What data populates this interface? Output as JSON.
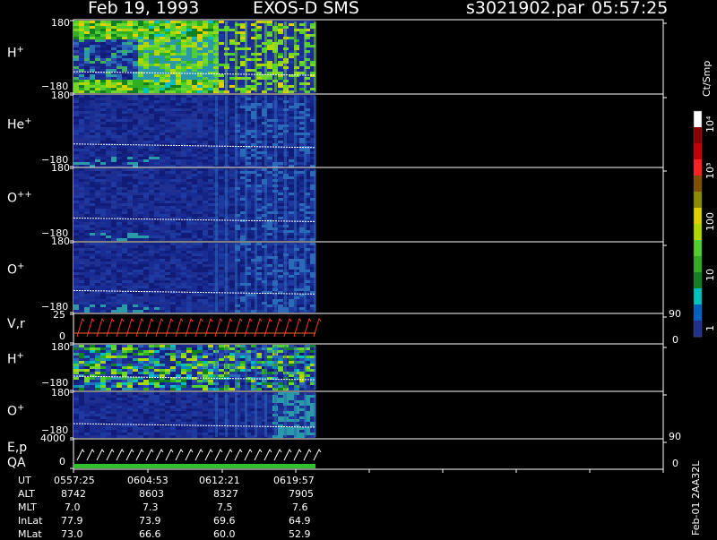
{
  "header": {
    "date": "Feb 19, 1993",
    "instrument": "EXOS-D SMS",
    "file": "s3021902.par",
    "time": "05:57:25"
  },
  "panels": [
    {
      "id": "p1",
      "species": "H",
      "charge": "+",
      "ytop": "180",
      "ybot": "−180",
      "scheme": "h"
    },
    {
      "id": "p2",
      "species": "He",
      "charge": "+",
      "ytop": "180",
      "ybot": "−180",
      "scheme": "low"
    },
    {
      "id": "p3",
      "species": "O",
      "charge": "++",
      "ytop": "180",
      "ybot": "−180",
      "scheme": "low"
    },
    {
      "id": "p4",
      "species": "O",
      "charge": "+",
      "ytop": "180",
      "ybot": "−180",
      "scheme": "low"
    },
    {
      "id": "p5",
      "species": "V,r",
      "ytop": "25",
      "ybot": "0",
      "right_top": "90",
      "right_bot": "0",
      "scheme": "line"
    },
    {
      "id": "p6",
      "species": "H",
      "charge": "+",
      "ytop": "180",
      "ybot": "−180",
      "scheme": "h2"
    },
    {
      "id": "p7",
      "species": "O",
      "charge": "+",
      "ytop": "180",
      "ybot": "−180",
      "scheme": "low2"
    },
    {
      "id": "p8",
      "species": "E,p",
      "species2": "QA",
      "ytop": "4000",
      "ybot": "0",
      "right_top": "90",
      "right_bot": "0",
      "scheme": "line2"
    }
  ],
  "footer": {
    "row_labels": [
      "UT",
      "ALT",
      "MLT",
      "InLat",
      "MLat"
    ],
    "columns": [
      [
        "0557:25",
        "8742",
        "7.0",
        "77.9",
        "73.0"
      ],
      [
        "0604:53",
        "8603",
        "7.3",
        "73.9",
        "66.6"
      ],
      [
        "0612:21",
        "8327",
        "7.5",
        "69.6",
        "60.0"
      ],
      [
        "0619:57",
        "7905",
        "7.6",
        "64.9",
        "52.9"
      ]
    ],
    "side_label": "Feb-01 2AA32L"
  },
  "colorbar": {
    "title": "Ct/Smp",
    "labels": [
      "10⁴",
      "10³",
      "100",
      "10",
      "1"
    ],
    "colors": [
      "#ffffff",
      "#8b0000",
      "#c00000",
      "#ff2020",
      "#805000",
      "#8c8c00",
      "#e0d000",
      "#b0d800",
      "#50d030",
      "#30b020",
      "#108020",
      "#00c0c0",
      "#0060c0",
      "#203090"
    ]
  },
  "chart_data": {
    "type": "heatmap",
    "title": "Feb 19, 1993  EXOS-D SMS",
    "x_ticks_ut": [
      "0557:25",
      "0604:53",
      "0612:21",
      "0619:57"
    ],
    "panels": [
      "H+",
      "He+",
      "O++",
      "O+",
      "V,r",
      "H+",
      "O+",
      "E,p / QA"
    ],
    "y_range_pitch": [
      -180,
      180
    ],
    "y_range_vr": [
      0,
      25
    ],
    "y_range_ep": [
      0,
      4000
    ],
    "color_scale": "log",
    "color_range": [
      1,
      10000
    ],
    "color_unit": "Ct/Smp"
  }
}
